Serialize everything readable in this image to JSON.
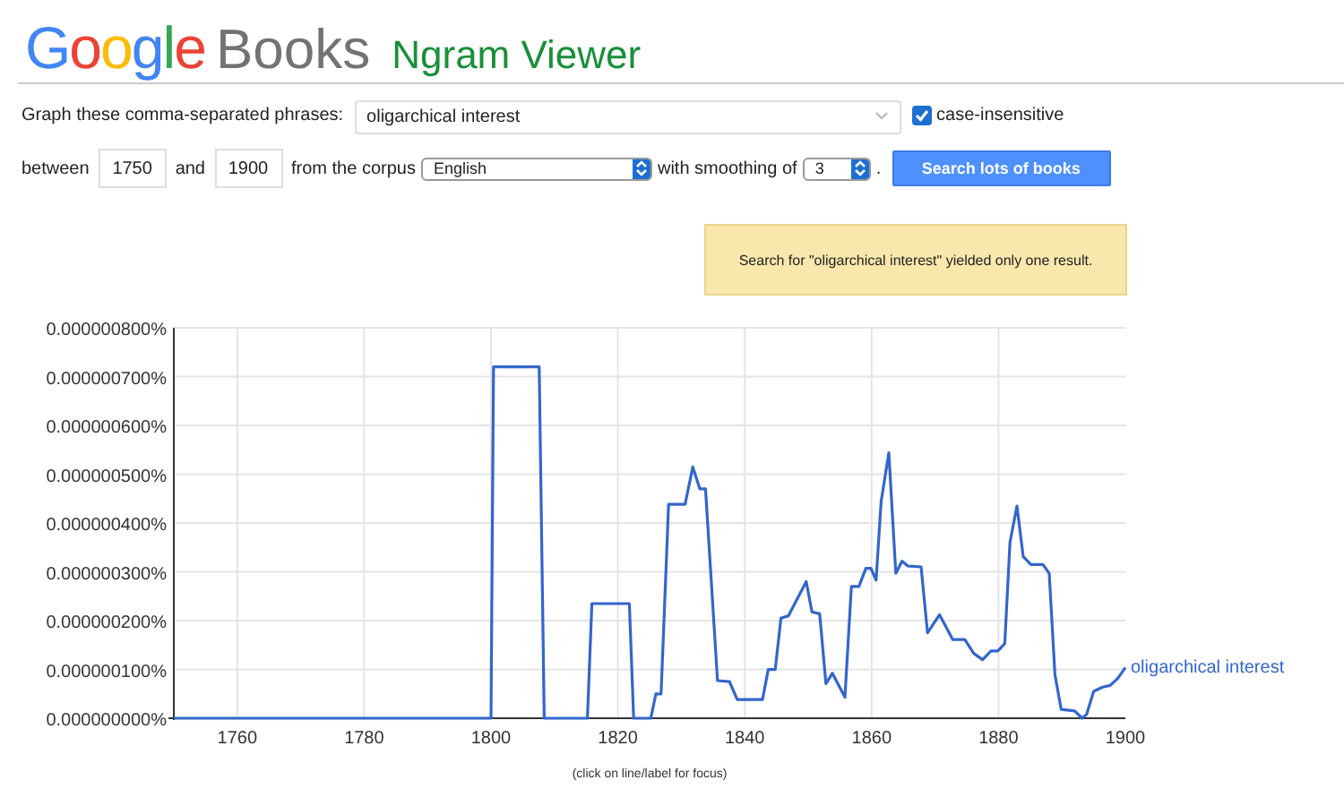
{
  "logo": {
    "brand": "Google",
    "product": "Books",
    "title": "Ngram Viewer"
  },
  "query": {
    "label": "Graph these comma-separated phrases:",
    "value": "oligarchical interest",
    "case_insensitive": {
      "label": "case-insensitive",
      "checked": true
    }
  },
  "range": {
    "label_between": "between",
    "start": "1750",
    "label_and": "and",
    "end": "1900",
    "label_corpus": "from the corpus",
    "corpus": "English",
    "label_smoothing": "with smoothing of",
    "smoothing": "3",
    "period": ".",
    "button": "Search lots of books"
  },
  "notice": "Search for \"oligarchical interest\" yielded only one result.",
  "chart": {
    "caption": "(click on line/label for focus)",
    "chart_data": {
      "type": "line",
      "x": [
        1750,
        1800,
        1800.4,
        1807.6,
        1808.4,
        1815.2,
        1815.9,
        1821.8,
        1822.5,
        1825.2,
        1826,
        1826.8,
        1828,
        1830.6,
        1831.8,
        1832.9,
        1833.8,
        1835.7,
        1837.6,
        1838.8,
        1842.8,
        1843.7,
        1844.8,
        1845.7,
        1846.9,
        1849.7,
        1850.6,
        1851.8,
        1852.8,
        1853.8,
        1855.8,
        1856.8,
        1858,
        1859.1,
        1859.9,
        1860.7,
        1861.5,
        1862.7,
        1863.8,
        1864.8,
        1865.7,
        1867.8,
        1868.8,
        1870.7,
        1872.8,
        1874.7,
        1876.1,
        1877.5,
        1878.8,
        1879.9,
        1881,
        1881.8,
        1882.9,
        1883.9,
        1885.1,
        1887,
        1888,
        1888.9,
        1889.9,
        1892,
        1893.2,
        1893.9,
        1895,
        1896.4,
        1897.6,
        1898.8,
        1900
      ],
      "series": [
        {
          "name": "oligarchical interest",
          "color": "#3366cc",
          "values": [
            0,
            0,
            7.2e-07,
            7.2e-07,
            0,
            0,
            2.35e-07,
            2.35e-07,
            0,
            0,
            5e-08,
            5e-08,
            4.38e-07,
            4.38e-07,
            5.15e-07,
            4.7e-07,
            4.7e-07,
            7.7e-08,
            7.5e-08,
            3.8e-08,
            3.8e-08,
            1e-07,
            1e-07,
            2.05e-07,
            2.1e-07,
            2.8e-07,
            2.18e-07,
            2.14e-07,
            7.1e-08,
            9.2e-08,
            4.3e-08,
            2.7e-07,
            2.7e-07,
            3.07e-07,
            3.07e-07,
            2.83e-07,
            4.44e-07,
            5.44e-07,
            2.97e-07,
            3.22e-07,
            3.12e-07,
            3.1e-07,
            1.75e-07,
            2.12e-07,
            1.61e-07,
            1.61e-07,
            1.33e-07,
            1.2e-07,
            1.38e-07,
            1.38e-07,
            1.53e-07,
            3.6e-07,
            4.35e-07,
            3.31e-07,
            3.15e-07,
            3.15e-07,
            2.97e-07,
            8.9e-08,
            1.8e-08,
            1.5e-08,
            0,
            8e-09,
            5.5e-08,
            6.4e-08,
            6.7e-08,
            8.2e-08,
            1.04e-07
          ]
        }
      ],
      "grid": true,
      "xlim": [
        1750,
        1900
      ],
      "ylim": [
        0,
        8e-07
      ],
      "xticks": [
        1760,
        1780,
        1800,
        1820,
        1840,
        1860,
        1880,
        1900
      ],
      "yticks": [
        {
          "value": 0,
          "label": "0.000000000%"
        },
        {
          "value": 1e-07,
          "label": "0.000000100%"
        },
        {
          "value": 2e-07,
          "label": "0.000000200%"
        },
        {
          "value": 3e-07,
          "label": "0.000000300%"
        },
        {
          "value": 4e-07,
          "label": "0.000000400%"
        },
        {
          "value": 5e-07,
          "label": "0.000000500%"
        },
        {
          "value": 6e-07,
          "label": "0.000000600%"
        },
        {
          "value": 7e-07,
          "label": "0.000000700%"
        },
        {
          "value": 8e-07,
          "label": "0.000000800%"
        }
      ]
    }
  }
}
